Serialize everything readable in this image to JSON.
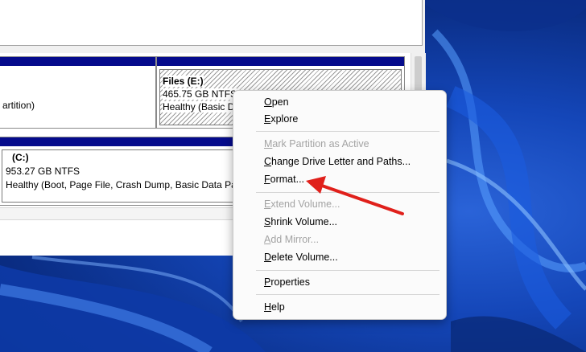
{
  "partitions": {
    "files_e": {
      "name": "Files  (E:)",
      "size": "465.75 GB NTFS",
      "status": "Healthy (Basic Da"
    },
    "left_partial": {
      "status": "artition)"
    },
    "c_drive": {
      "name": "(C:)",
      "size": "953.27 GB NTFS",
      "status": "Healthy (Boot, Page File, Crash Dump, Basic Data Part"
    }
  },
  "context_menu": {
    "items": [
      {
        "accel": "O",
        "rest": "pen",
        "enabled": true
      },
      {
        "accel": "E",
        "rest": "xplore",
        "enabled": true
      },
      {
        "accel": "M",
        "rest": "ark Partition as Active",
        "enabled": false
      },
      {
        "accel": "C",
        "rest": "hange Drive Letter and Paths...",
        "enabled": true
      },
      {
        "accel": "F",
        "rest": "ormat...",
        "enabled": true
      },
      {
        "accel": "E",
        "rest": "xtend Volume...",
        "enabled": false
      },
      {
        "accel": "S",
        "rest": "hrink Volume...",
        "enabled": true
      },
      {
        "accel": "A",
        "rest": "dd Mirror...",
        "enabled": false
      },
      {
        "accel": "D",
        "rest": "elete Volume...",
        "enabled": true
      },
      {
        "accel": "P",
        "rest": "roperties",
        "enabled": true
      },
      {
        "accel": "H",
        "rest": "elp",
        "enabled": true
      }
    ]
  },
  "colors": {
    "partition_header": "#050b8c",
    "annotation_arrow": "#e0201b",
    "disabled_text": "#a3a3a3"
  },
  "annotation": {
    "target": "Format...",
    "icon": "red-arrow-icon"
  }
}
